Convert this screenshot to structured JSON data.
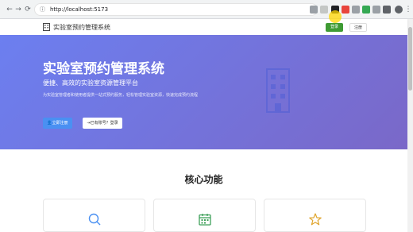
{
  "browser": {
    "url": "http://localhost:5173"
  },
  "header": {
    "brand_name": "实验室预约管理系统",
    "login_label": "登录",
    "register_label": "注册"
  },
  "hero": {
    "title": "实验室预约管理系统",
    "subtitle": "便捷、高效的实验室资源管理平台",
    "description": "为实验室管理者和使用者提供一站式预约服务，轻松管理实验室资源，快速完成预约流程",
    "primary_button": "立即注册",
    "secondary_button": "已有账号？登录"
  },
  "features": {
    "title": "核心功能",
    "cards": [
      {
        "icon": "search-icon"
      },
      {
        "icon": "calendar-icon"
      },
      {
        "icon": "star-icon"
      }
    ]
  },
  "colors": {
    "accent_green": "#3f9b34",
    "hero_gradient_start": "#6c7ff0",
    "hero_gradient_end": "#7a68c8",
    "primary_blue": "#4a90f2"
  }
}
